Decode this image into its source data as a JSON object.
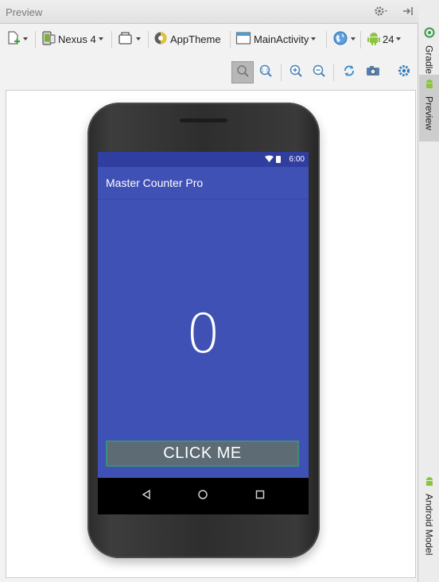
{
  "panel": {
    "title": "Preview"
  },
  "toolbar": {
    "device": "Nexus 4",
    "theme": "AppTheme",
    "activity": "MainActivity",
    "api": "24"
  },
  "sidebar": {
    "gradle": "Gradle",
    "preview": "Preview",
    "android_model": "Android Model"
  },
  "device_screen": {
    "status_time": "6:00",
    "app_title": "Master Counter Pro",
    "counter_value": "0",
    "button_label": "CLICK ME"
  },
  "colors": {
    "primary": "#3f51b5",
    "primary_dark": "#303f9f",
    "button": "#5d6b75",
    "button_border": "#3c8e79"
  }
}
